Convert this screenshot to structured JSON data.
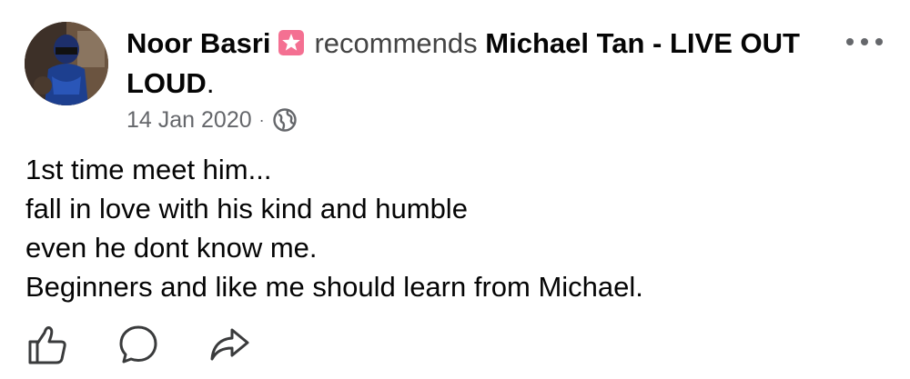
{
  "post": {
    "author": "Noor Basri",
    "verb": "recommends",
    "page": "Michael Tan - LIVE OUT LOUD",
    "page_suffix": ".",
    "date": "14 Jan 2020",
    "separator": "·",
    "privacy_icon": "globe-icon",
    "badge_icon": "recommendation-star-badge-icon",
    "more_icon": "more-options-icon",
    "body_lines": [
      "1st time meet him...",
      "fall in love with his kind and humble",
      "even he dont know me.",
      "Beginners and like me should learn from Michael."
    ]
  },
  "actions": [
    {
      "icon": "like-icon"
    },
    {
      "icon": "comment-icon"
    },
    {
      "icon": "share-icon"
    }
  ],
  "colors": {
    "text": "#050505",
    "secondary": "#65676b",
    "badge": "#e8547e"
  }
}
